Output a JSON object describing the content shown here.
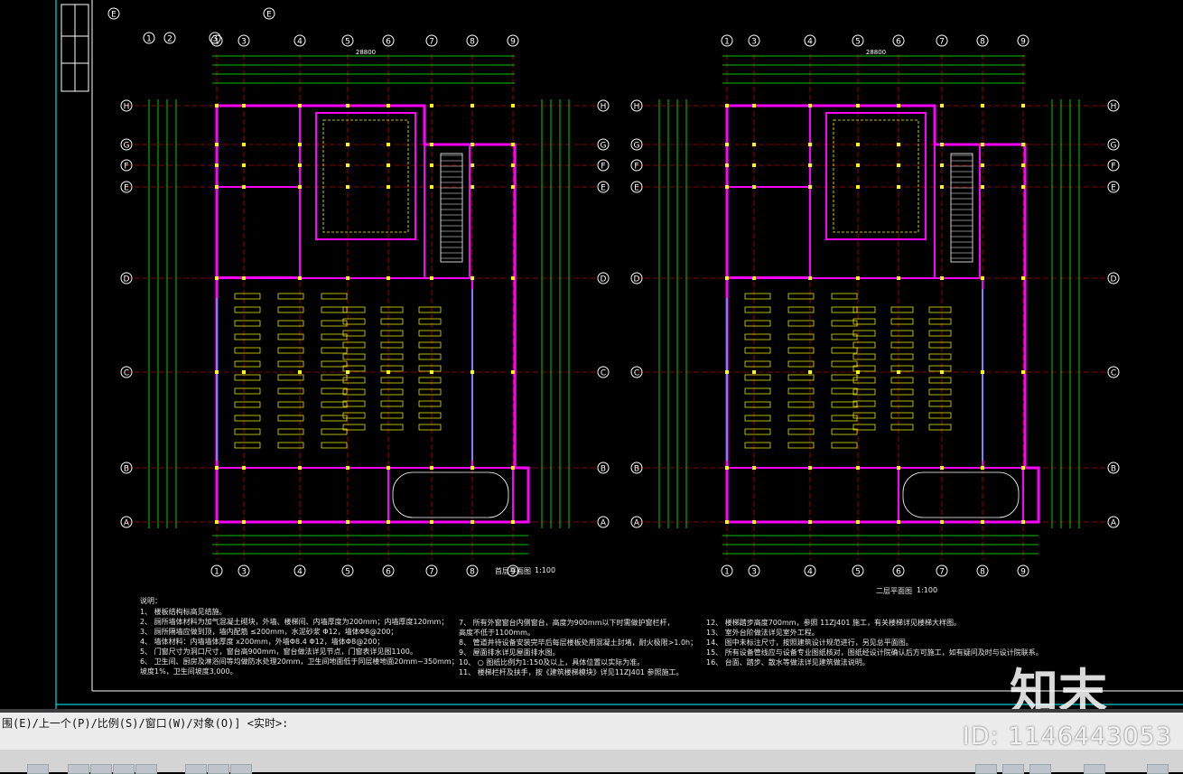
{
  "drawing": {
    "plan1_title": "首层平面图",
    "plan1_scale": "1:100",
    "plan2_title": "二层平面图",
    "plan2_scale": "1:100",
    "axes_top": [
      "1",
      "3",
      "4",
      "5",
      "6",
      "7",
      "8",
      "9"
    ],
    "axes_left": [
      "H",
      "G",
      "F",
      "E",
      "D",
      "C",
      "B",
      "A"
    ],
    "top_extra_axes": [
      "1",
      "2",
      "3"
    ],
    "dimension_total": "28800",
    "notes_heading": "说明：",
    "notes_left": [
      "1、  楼板结构标高见结施。",
      "2、  厕所墙体材料为加气混凝土砌块，外墙、楼梯间、内墙厚度为200mm；内墙厚度120mm；",
      "3、  厕所隔墙应做到顶，墙内配筋 ≤200mm，水泥砂浆 Φ12，墙体Φ8@200；",
      "4、  墙体材料：内墙墙体厚度 x200mm，外墙Φ8.4 Φ12，墙体Φ8@200；",
      "5、  门窗尺寸为洞口尺寸，窗台高900mm，窗台做法详见节点，门窗表详见图1100。",
      "6、  卫生间、厨房及淋浴间等均做防水处理20mm，卫生间地面低于同层楼地面20mm~350mm；",
      "     坡度1%，卫生间坡度3,000。"
    ],
    "notes_mid": [
      "7、  所有外窗窗台内侧窗台，高度为900mm以下时需做护窗栏杆，",
      "     高度不低于1100mm。",
      "8、  管道井待设备安装完毕后每层楼板处用混凝土封堵，耐火极限>1.0h；",
      "9、  屋面排水详见屋面排水图。",
      "10、 ○ 图纸比例为1:150及以上，具体位置以实际为准。",
      "11、 楼梯栏杆及扶手，按《建筑楼梯模块》详见11ZJ401 参照施工。"
    ],
    "notes_right": [
      "12、 楼梯踏步高度700mm，参照 11ZJ401 施工，有关楼梯详见楼梯大样图。",
      "13、 室外台阶做法详见室外工程。",
      "14、 图中未标注尺寸，按照建筑设计规范进行，另见总平面图。",
      "15、 所有设备管线应与设备专业图纸核对，图纸经设计院确认后方可施工，如有疑问及时与设计院联系。",
      "16、 台面、踏步、散水等做法详见建筑做法说明。"
    ]
  },
  "command": {
    "prompt": "围(E)/上一个(P)/比例(S)/窗口(W)/对象(O)] <实时>:"
  },
  "watermark": {
    "logo": "知末",
    "id": "ID: 1146443053"
  },
  "colors": {
    "background": "#000000",
    "walls": "#ff00ff",
    "axis": "#00ff00",
    "dims": "#ffffff",
    "yellow": "#ffff00",
    "cyan": "#00ffff",
    "red": "#ff0000"
  }
}
